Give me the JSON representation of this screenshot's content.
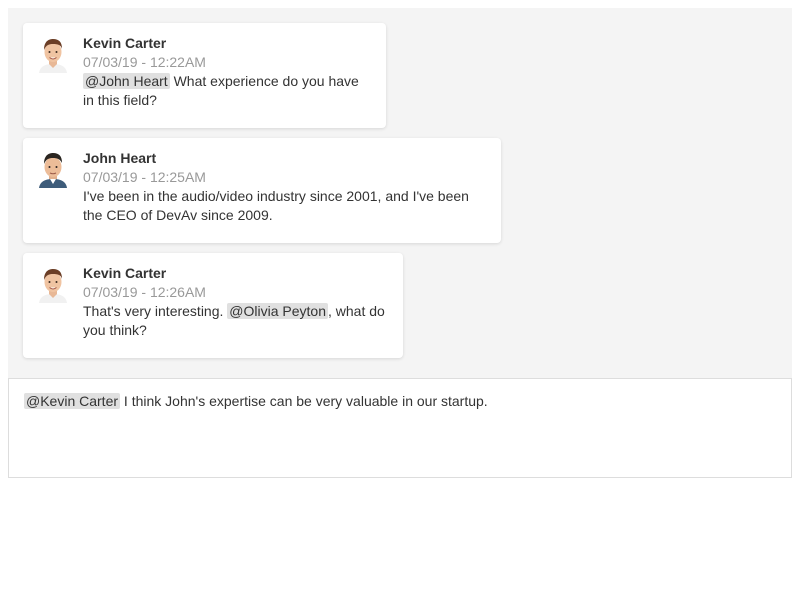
{
  "messages": [
    {
      "author": "Kevin Carter",
      "timestamp": "07/03/19 - 12:22AM",
      "mention": "@John Heart",
      "text_after": " What experience do you have in this field?",
      "avatar": "kevin-carter-avatar"
    },
    {
      "author": "John Heart",
      "timestamp": "07/03/19 - 12:25AM",
      "text": "I've been in the audio/video industry since 2001, and I've been the CEO of DevAv since 2009.",
      "avatar": "john-heart-avatar"
    },
    {
      "author": "Kevin Carter",
      "timestamp": "07/03/19 - 12:26AM",
      "text_before": "That's very interesting. ",
      "mention": "@Olivia Peyton",
      "text_after": ", what do you think?",
      "avatar": "kevin-carter-avatar"
    }
  ],
  "composer": {
    "mention": "@Kevin Carter",
    "text": " I think John's expertise can be very valuable in our startup."
  },
  "colors": {
    "panel_bg": "#f4f4f4",
    "card_bg": "#ffffff",
    "mention_bg": "#e0e0e0",
    "timestamp": "#999999",
    "text": "#333333"
  }
}
